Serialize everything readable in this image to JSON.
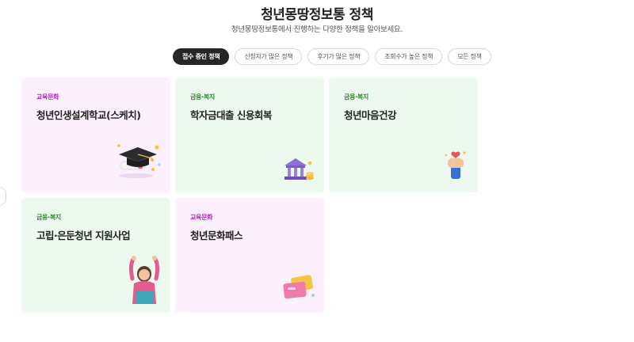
{
  "header": {
    "title": "청년몽땅정보통 정책",
    "subtitle": "청년몽땅정보통에서 진행하는 다양한 정책을 알아보세요."
  },
  "filters": [
    {
      "label": "접수 중인 정책",
      "active": true
    },
    {
      "label": "신청자가 많은 정책",
      "active": false
    },
    {
      "label": "후기가 많은 정책",
      "active": false
    },
    {
      "label": "조회수가 높은 정책",
      "active": false
    },
    {
      "label": "모든 정책",
      "active": false
    }
  ],
  "cards": [
    {
      "category": "교육문화",
      "title": "청년인생설계학교(스케치)",
      "icon": "graduation-cap-icon",
      "theme": "pink"
    },
    {
      "category": "금융·복지",
      "title": "학자금대출 신용회복",
      "icon": "bank-coins-icon",
      "theme": "green"
    },
    {
      "category": "금융·복지",
      "title": "청년마음건강",
      "icon": "hand-heart-icon",
      "theme": "green"
    },
    {
      "category": "금융·복지",
      "title": "고립·은둔청년 지원사업",
      "icon": "person-stretching-icon",
      "theme": "green"
    },
    {
      "category": "교육문화",
      "title": "청년문화패스",
      "icon": "culture-pass-cards-icon",
      "theme": "pink"
    }
  ],
  "colors": {
    "pink_bg": "#fbf0fc",
    "green_bg": "#edf9ee",
    "pink_category": "#b12cb5",
    "green_category": "#2f8a2f",
    "active_chip": "#262626"
  }
}
